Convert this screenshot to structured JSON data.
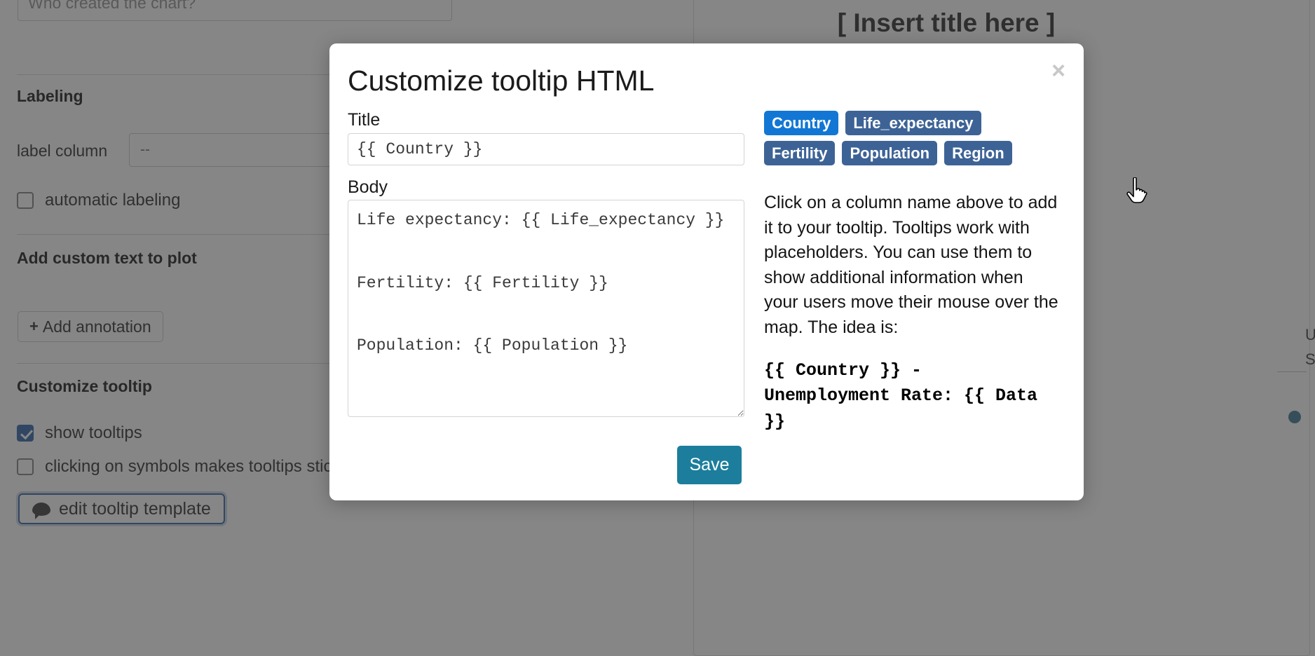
{
  "background": {
    "top_input_placeholder": "Who created the chart?",
    "sections": {
      "labeling": "Labeling",
      "add_custom_text": "Add custom text to plot",
      "customize_tooltip": "Customize tooltip"
    },
    "label_column_label": "label column",
    "label_column_value": "--",
    "automatic_labeling_label": "automatic labeling",
    "add_annotation_label": "Add annotation",
    "show_tooltips_label": "show tooltips",
    "sticky_tooltips_label": "clicking on symbols makes tooltips sticky",
    "edit_tooltip_template_label": "edit tooltip template",
    "chart_title": "[ Insert title here ]",
    "axis_label_line1": "U",
    "axis_label_line2": "S"
  },
  "modal": {
    "title": "Customize tooltip HTML",
    "close_label": "×",
    "title_field": {
      "label": "Title",
      "value": "{{ Country }}"
    },
    "body_field": {
      "label": "Body",
      "value": "Life expectancy: {{ Life_expectancy }}\n\nFertility: {{ Fertility }}\n\nPopulation: {{ Population }}"
    },
    "columns": [
      {
        "name": "Country",
        "active": true
      },
      {
        "name": "Life_expectancy",
        "active": false
      },
      {
        "name": "Fertility",
        "active": false
      },
      {
        "name": "Population",
        "active": false
      },
      {
        "name": "Region",
        "active": false
      }
    ],
    "helper_text": "Click on a column name above to add it to your tooltip. Tooltips work with placeholders. You can use them to show additional information when your users move their mouse over the map. The idea is:",
    "helper_example": "{{ Country }} - Unemployment Rate: {{ Data }}",
    "save_label": "Save"
  },
  "colors": {
    "badge": "#3d6396",
    "badge_active": "#1277d4",
    "save_button": "#1c7e9c",
    "checkbox_checked": "#3d6fb0",
    "focus_ring": "#3f6fad",
    "overlay": "rgba(40,40,40,0.56)"
  }
}
